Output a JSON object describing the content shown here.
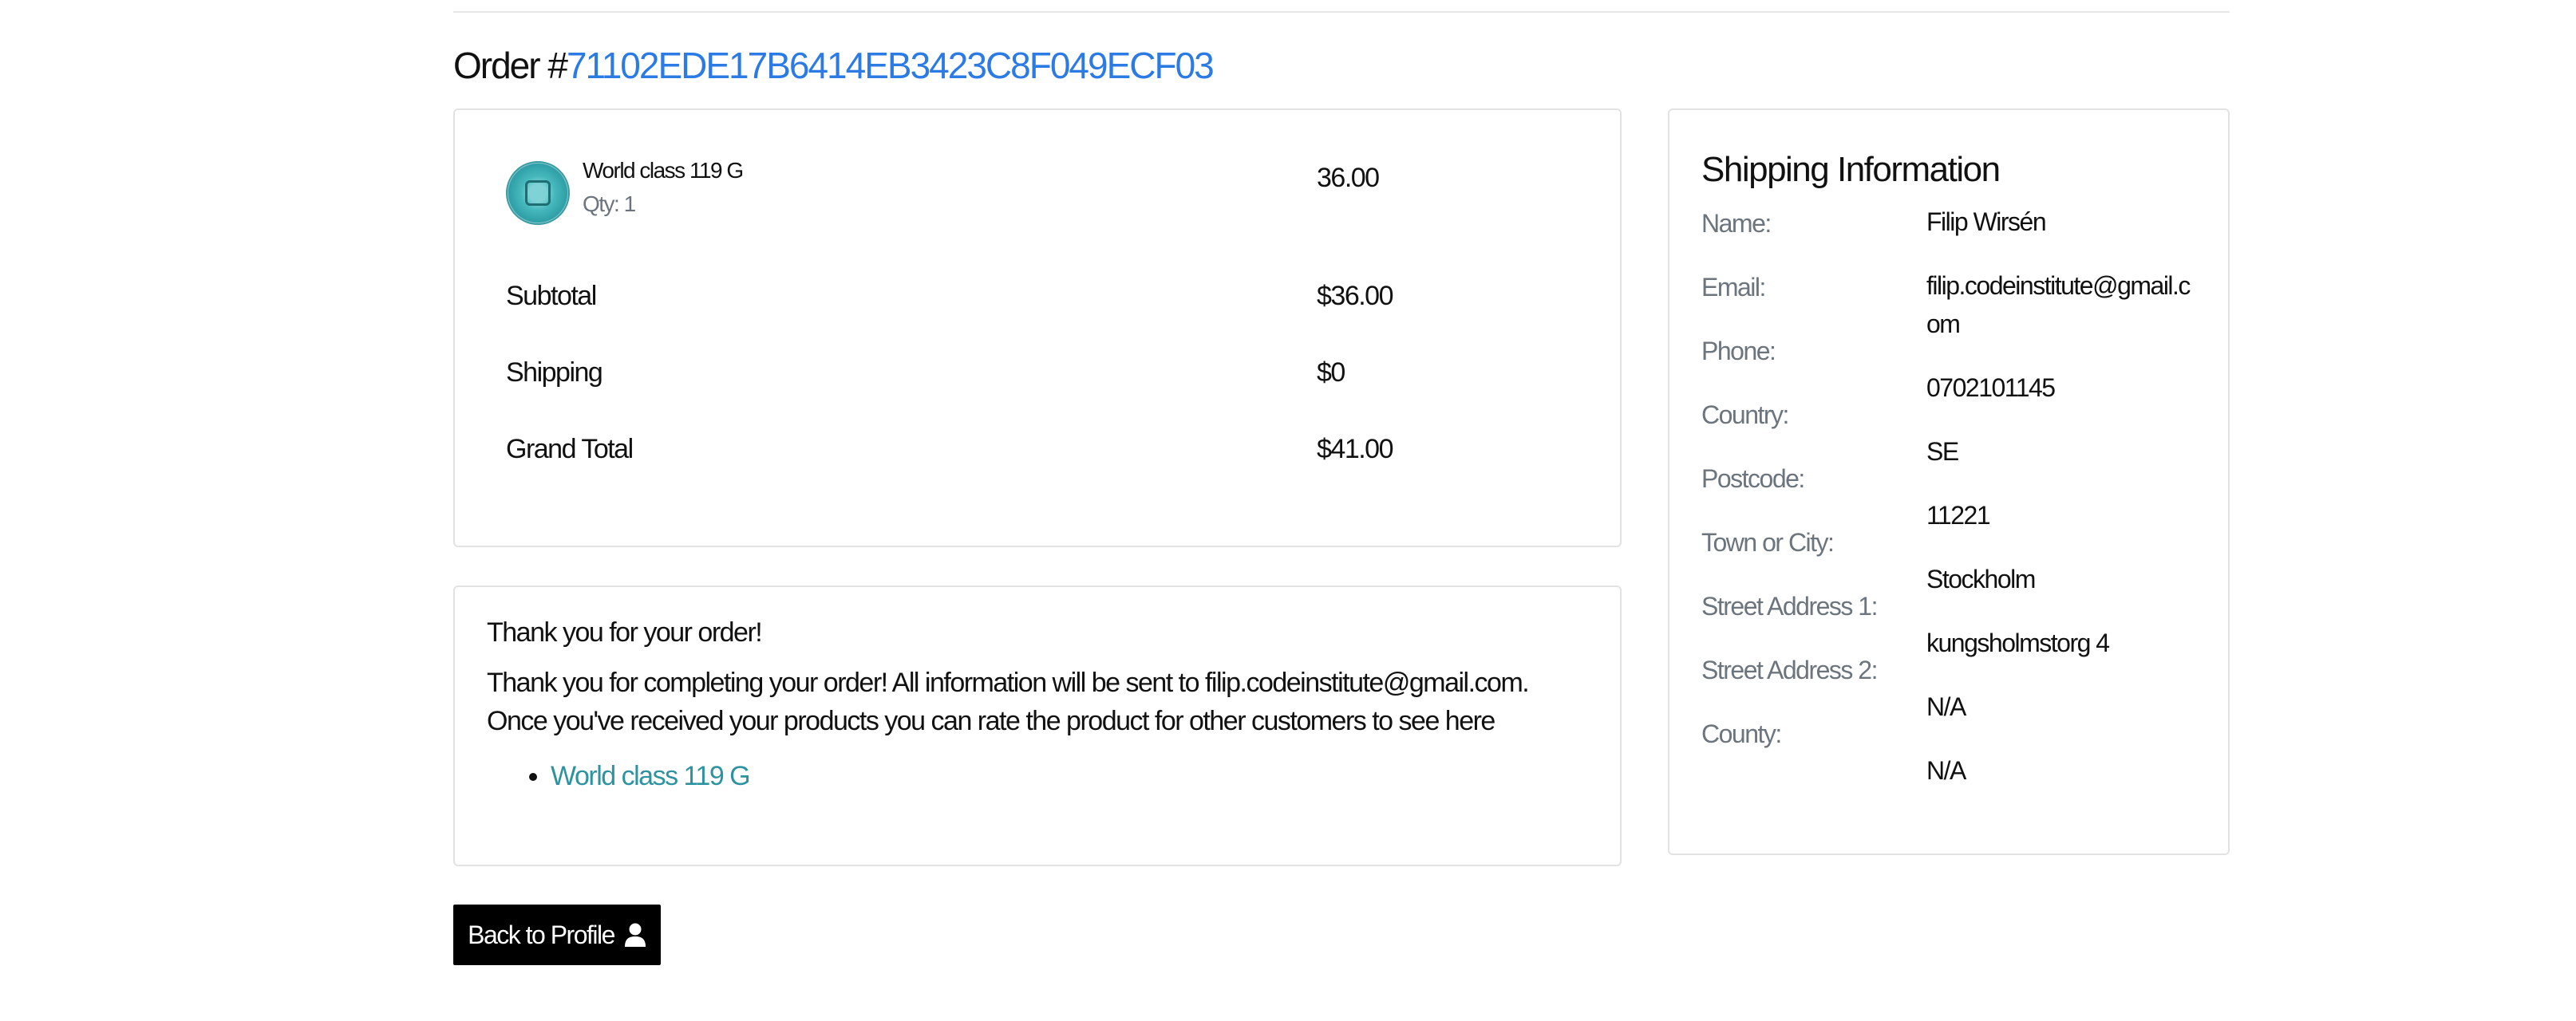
{
  "order": {
    "prefix": "Order #",
    "number": "71102EDE17B6414EB3423C8F049ECF03"
  },
  "summary": {
    "item": {
      "name": "World class 119 G",
      "qty": "Qty: 1",
      "price": "36.00",
      "thumbnail_icon": "disc-product-icon"
    },
    "rows": [
      {
        "label": "Subtotal",
        "value": "$36.00"
      },
      {
        "label": "Shipping",
        "value": "$0"
      },
      {
        "label": "Grand Total",
        "value": "$41.00"
      }
    ]
  },
  "thanks": {
    "title": "Thank you for your order!",
    "text": "Thank you for completing your order! All information will be sent to filip.codeinstitute@gmail.com. Once you've received your products you can rate the product for other customers to see here",
    "products": [
      "World class 119 G"
    ],
    "link_color": "#2e93a0"
  },
  "shipping": {
    "title": "Shipping Information",
    "labels": [
      "Name:",
      "Email:",
      "Phone:",
      "Country:",
      "Postcode:",
      "Town or City:",
      "Street Address 1:",
      "Street Address 2:",
      "County:"
    ],
    "values": [
      "Filip Wirsén",
      "filip.codeinstitute@gmail.com",
      "0702101145",
      "SE",
      "11221",
      "Stockholm",
      "kungsholmstorg 4",
      "N/A",
      "N/A"
    ]
  },
  "back_button": {
    "label": "Back to Profile",
    "icon": "user-icon"
  },
  "colors": {
    "accent": "#2c7be5",
    "button_bg": "#000000",
    "muted": "#6c757d"
  }
}
